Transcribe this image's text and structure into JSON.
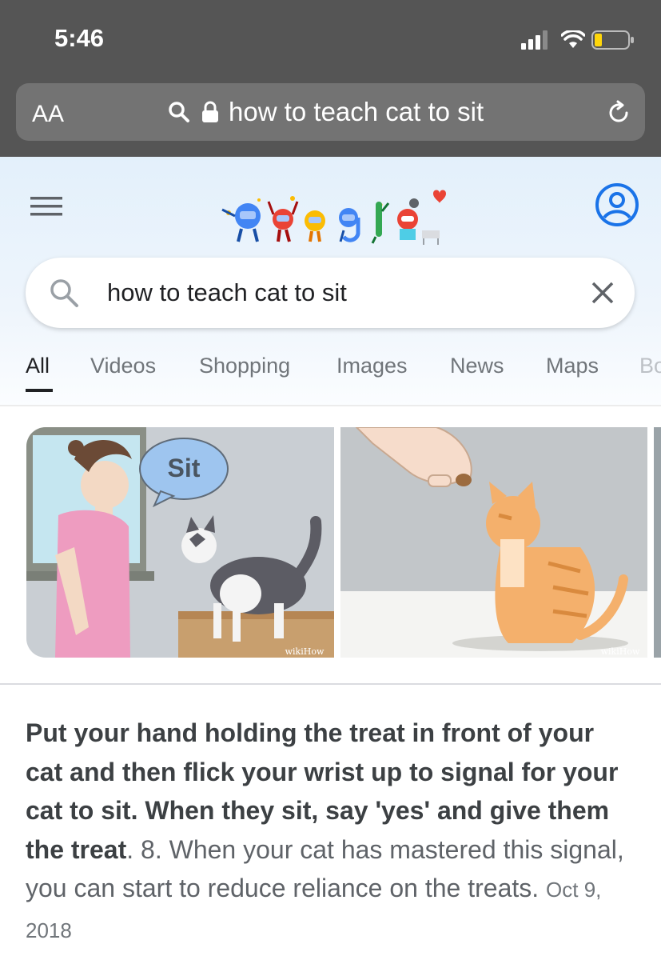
{
  "status_bar": {
    "time": "5:46"
  },
  "browser": {
    "text_size_label": "AA",
    "url_text": "how to teach cat to sit"
  },
  "search": {
    "query": "how to teach cat to sit"
  },
  "tabs": [
    {
      "label": "All",
      "active": true
    },
    {
      "label": "Videos"
    },
    {
      "label": "Shopping"
    },
    {
      "label": "Images"
    },
    {
      "label": "News"
    },
    {
      "label": "Maps"
    },
    {
      "label": "Bo"
    }
  ],
  "images": [
    {
      "speech_bubble": "Sit",
      "watermark": "wikiHow"
    },
    {
      "watermark": "wikiHow"
    }
  ],
  "snippet": {
    "bold_text": "Put your hand holding the treat in front of your cat and then flick your wrist up to signal for your cat to sit. When they sit, say 'yes' and give them the treat",
    "rest_text": ". 8. When your cat has mastered this signal, you can start to reduce reliance on the treats.",
    "date": "Oct 9, 2018"
  },
  "colors": {
    "status_bar": "#555555",
    "url_bar": "#737373",
    "google_blue": "#1a73e8",
    "header_bg": "#e3f0fb"
  },
  "icons": [
    "signal-icon",
    "wifi-icon",
    "battery-icon",
    "search-icon",
    "lock-icon",
    "reload-icon",
    "menu-icon",
    "google-doodle",
    "account-icon",
    "clear-icon"
  ]
}
